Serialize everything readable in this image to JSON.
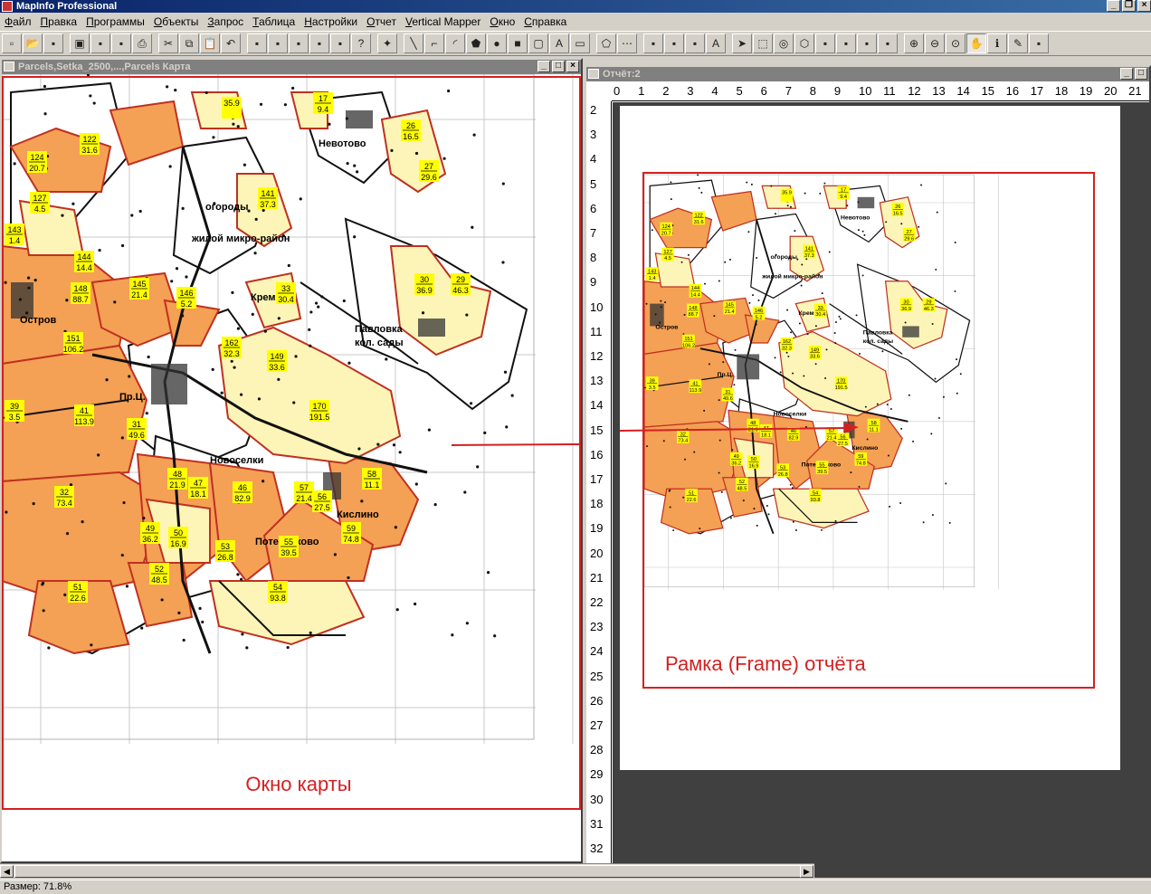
{
  "app": {
    "title": "MapInfo Professional"
  },
  "menu": [
    "Файл",
    "Правка",
    "Программы",
    "Объекты",
    "Запрос",
    "Таблица",
    "Настройки",
    "Отчет",
    "Vertical Mapper",
    "Окно",
    "Справка"
  ],
  "toolbar": {
    "icons": [
      "new-icon",
      "open-icon",
      "open-workspace-icon",
      "save-icon",
      "save-workspace-icon",
      "print-preview-icon",
      "print-icon",
      "cut-icon",
      "copy-icon",
      "paste-icon",
      "undo-icon",
      "new-browser-icon",
      "new-map-icon",
      "new-graph-icon",
      "new-layout-icon",
      "redistrict-icon",
      "help-icon",
      "symbol-icon",
      "line-icon",
      "polyline-icon",
      "arc-icon",
      "polygon-icon",
      "ellipse-icon",
      "rectangle-icon",
      "rounded-rect-icon",
      "text-icon",
      "frame-icon",
      "reshape-icon",
      "add-node-icon",
      "symbol-style-icon",
      "line-style-icon",
      "region-style-icon",
      "text-style-icon",
      "select-icon",
      "marquee-select-icon",
      "radius-select-icon",
      "polygon-select-icon",
      "boundary-select-icon",
      "unselect-all-icon",
      "invert-select-icon",
      "graph-select-icon",
      "zoom-in-icon",
      "zoom-out-icon",
      "change-view-icon",
      "grabber-icon",
      "info-icon",
      "label-icon",
      "drag-map-icon"
    ]
  },
  "map_window": {
    "title": "Parcels,Setka_2500,...,Parcels Карта",
    "caption": "Окно карты",
    "places": [
      "Невотово",
      "Крем",
      "Павловка",
      "кол. сады",
      "Остров",
      "Пр.Ц.",
      "Новоселки",
      "Кислино",
      "Потенчаково",
      "огороды",
      "жилой микро-район"
    ],
    "parcels": [
      {
        "id": "124",
        "area": "20.7"
      },
      {
        "id": "122",
        "area": "31.6"
      },
      {
        "id": "127",
        "area": "4.5"
      },
      {
        "id": "143",
        "area": "1.4"
      },
      {
        "id": "144",
        "area": "14.4"
      },
      {
        "id": "148",
        "area": "88.7"
      },
      {
        "id": "145",
        "area": "21.4"
      },
      {
        "id": "146",
        "area": "5.2"
      },
      {
        "id": "141",
        "area": "37.3"
      },
      {
        "id": "33",
        "area": "30.4"
      },
      {
        "id": "26",
        "area": "16.5"
      },
      {
        "id": "27",
        "area": "29.6"
      },
      {
        "id": "30",
        "area": "36.9"
      },
      {
        "id": "29",
        "area": "46.3"
      },
      {
        "id": "151",
        "area": "106.2"
      },
      {
        "id": "162",
        "area": "32.3"
      },
      {
        "id": "149",
        "area": "33.6"
      },
      {
        "id": "170",
        "area": "191.5"
      },
      {
        "id": "39",
        "area": "3.5"
      },
      {
        "id": "41",
        "area": "113.9"
      },
      {
        "id": "31",
        "area": "49.6"
      },
      {
        "id": "48",
        "area": "21.9"
      },
      {
        "id": "47",
        "area": "18.1"
      },
      {
        "id": "46",
        "area": "82.9"
      },
      {
        "id": "57",
        "area": "21.4"
      },
      {
        "id": "56",
        "area": "27.5"
      },
      {
        "id": "58",
        "area": "11.1"
      },
      {
        "id": "32",
        "area": "73.4"
      },
      {
        "id": "49",
        "area": "36.2"
      },
      {
        "id": "50",
        "area": "16.9"
      },
      {
        "id": "53",
        "area": "26.8"
      },
      {
        "id": "55",
        "area": "39.5"
      },
      {
        "id": "59",
        "area": "74.8"
      },
      {
        "id": "52",
        "area": "48.5"
      },
      {
        "id": "51",
        "area": "22.6"
      },
      {
        "id": "54",
        "area": "93.8"
      },
      {
        "id": "17",
        "area": "9.4"
      },
      {
        "id": "35.9",
        "area": ""
      }
    ]
  },
  "report_window": {
    "title": "Отчёт:2",
    "frame_caption": "Рамка (Frame) отчёта",
    "ruler_h": [
      "0",
      "1",
      "2",
      "3",
      "4",
      "5",
      "6",
      "7",
      "8",
      "9",
      "10",
      "11",
      "12",
      "13",
      "14",
      "15",
      "16",
      "17",
      "18",
      "19",
      "20",
      "21"
    ],
    "ruler_v": [
      "2",
      "3",
      "4",
      "5",
      "6",
      "7",
      "8",
      "9",
      "10",
      "11",
      "12",
      "13",
      "14",
      "15",
      "16",
      "17",
      "18",
      "19",
      "20",
      "21",
      "22",
      "23",
      "24",
      "25",
      "26",
      "27",
      "28",
      "29",
      "30",
      "31",
      "32"
    ]
  },
  "status": {
    "zoom": "Размер: 71.8%"
  },
  "colors": {
    "frame_red": "#d42020",
    "orange": "#f4a055",
    "light": "#fdf5b8",
    "label_yellow": "#ffff00",
    "title_inactive": "#808080"
  }
}
